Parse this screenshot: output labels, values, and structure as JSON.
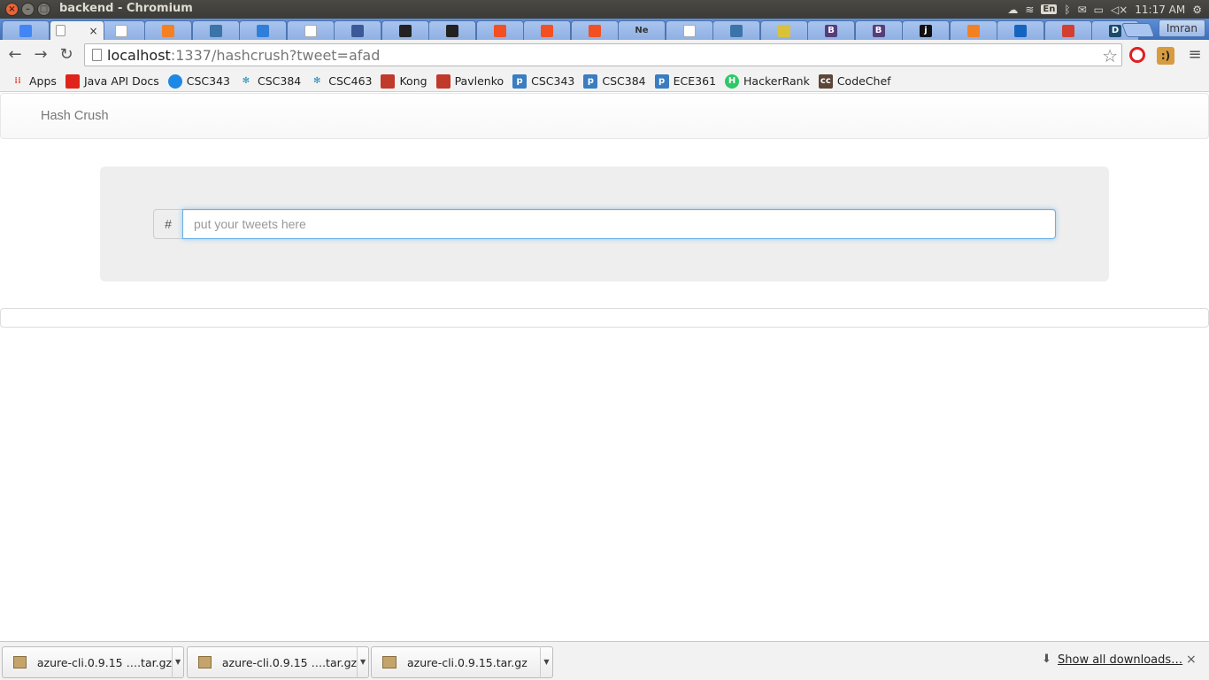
{
  "os": {
    "window_title": "backend - Chromium",
    "keyboard_lang": "En",
    "clock": "11:17 AM",
    "user": "Imran"
  },
  "tabs": {
    "active_close": "×",
    "favicons": [
      "docs",
      "page",
      "stack",
      "python",
      "edge",
      "page",
      "facebook",
      "github",
      "github",
      "windows",
      "windows",
      "windows",
      "Ne",
      "page",
      "python",
      "sun",
      "B",
      "B",
      "j",
      "stack",
      "wave",
      "gmail",
      "D"
    ]
  },
  "toolbar": {
    "url_host": "localhost",
    "url_rest": ":1337/hashcrush?tweet=afad"
  },
  "bookmarks": [
    {
      "label": "Apps",
      "icon": "apps-grid-icon",
      "color": "#e84c3d"
    },
    {
      "label": "Java API Docs",
      "icon": "oracle-icon",
      "color": "#e0241b"
    },
    {
      "label": "CSC343",
      "icon": "blue-circle-icon",
      "color": "#1e88e5"
    },
    {
      "label": "CSC384",
      "icon": "snowflake-icon",
      "color": "#1a8ab8"
    },
    {
      "label": "CSC463",
      "icon": "snowflake-icon",
      "color": "#1a8ab8"
    },
    {
      "label": "Kong",
      "icon": "crest-icon",
      "color": "#c0392b"
    },
    {
      "label": "Pavlenko",
      "icon": "crest-icon",
      "color": "#c0392b"
    },
    {
      "label": "CSC343",
      "icon": "p-icon",
      "color": "#3a7dc0"
    },
    {
      "label": "CSC384",
      "icon": "p-icon",
      "color": "#3a7dc0"
    },
    {
      "label": "ECE361",
      "icon": "p-icon",
      "color": "#3a7dc0"
    },
    {
      "label": "HackerRank",
      "icon": "hackerrank-icon",
      "color": "#2ec866"
    },
    {
      "label": "CodeChef",
      "icon": "codechef-icon",
      "color": "#5b4638"
    }
  ],
  "page": {
    "brand": "Hash Crush",
    "addon": "#",
    "placeholder": "put your tweets here"
  },
  "downloads": {
    "items": [
      "azure-cli.0.9.15 ….tar.gz",
      "azure-cli.0.9.15 ….tar.gz",
      "azure-cli.0.9.15.tar.gz"
    ],
    "show_all": "Show all downloads…",
    "close": "×"
  }
}
